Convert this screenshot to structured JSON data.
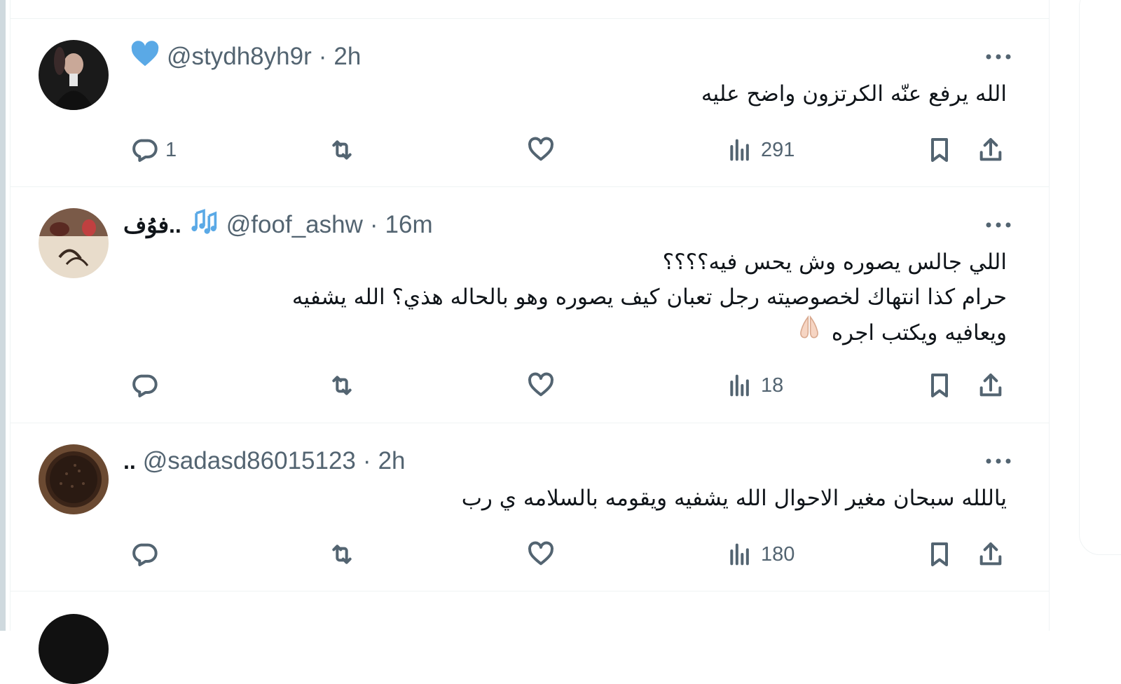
{
  "replies": [
    {
      "display_name": "",
      "badge_icon": "blue-heart-icon",
      "handle": "@stydh8yh9r",
      "separator": "·",
      "time": "2h",
      "text_lines": [
        "الله يرفع عنّه الكرتزون واضح عليه"
      ],
      "reply_count": "1",
      "retweet_count": "",
      "like_count": "",
      "view_count": "291"
    },
    {
      "display_name": "فوُف..",
      "badge_icon": "music-notes-icon",
      "handle": "@foof_ashw",
      "separator": "·",
      "time": "16m",
      "text_lines": [
        "اللي جالس يصوره وش يحس فيه؟؟؟؟",
        "حرام كذا انتهاك لخصوصيته رجل تعبان كيف يصوره وهو بالحاله هذي؟ الله يشفيه",
        "ويعافيه ويكتب اجره"
      ],
      "reply_count": "",
      "retweet_count": "",
      "like_count": "",
      "view_count": "18"
    },
    {
      "display_name": "..",
      "badge_icon": "",
      "handle": "@sadasd86015123",
      "separator": "·",
      "time": "2h",
      "text_lines": [
        "ياللله سبحان مغير الاحوال الله يشفيه ويقومه بالسلامه ي رب"
      ],
      "reply_count": "",
      "retweet_count": "",
      "like_count": "",
      "view_count": "180"
    }
  ],
  "colors": {
    "text_primary": "#0f1419",
    "text_secondary": "#536471",
    "border": "#eff3f4",
    "heart_badge": "#5aa9e6"
  }
}
